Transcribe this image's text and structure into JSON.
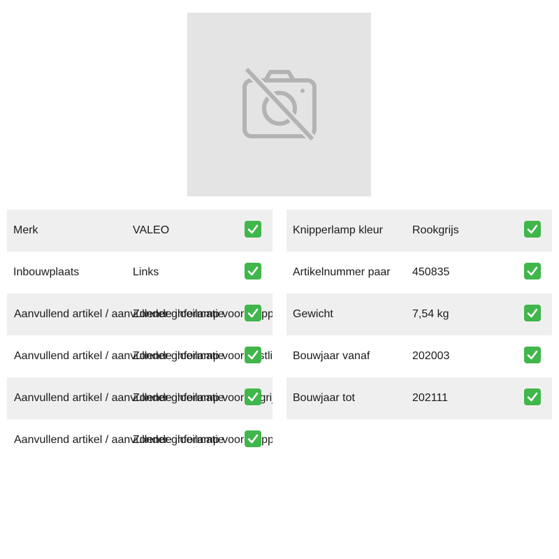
{
  "photo": {
    "icon": "no-camera-icon"
  },
  "left_rows": [
    {
      "label": "Merk",
      "value": "VALEO"
    },
    {
      "label": "Inbouwplaats",
      "value": "Links"
    },
    {
      "label": "Aanvullend artikel / aanvullende informatie",
      "value": "Zonder gloeilamp voor knipperlicht"
    },
    {
      "label": "Aanvullend artikel / aanvullende informatie",
      "value": "Zonder gloeilamp voor mistlicht"
    },
    {
      "label": "Aanvullend artikel / aanvullende informatie",
      "value": "Zonder gloeilamp voor dagrijverlichting"
    },
    {
      "label": "Aanvullend artikel / aanvullende informatie",
      "value": "Zonder gloeilamp voor knipperlicht"
    }
  ],
  "right_rows": [
    {
      "label": "Knipperlamp kleur",
      "value": "Rookgrijs"
    },
    {
      "label": "Artikelnummer paar",
      "value": "450835"
    },
    {
      "label": "Gewicht",
      "value": "7,54 kg"
    },
    {
      "label": "Bouwjaar vanaf",
      "value": "202003"
    },
    {
      "label": "Bouwjaar tot",
      "value": "202111"
    }
  ],
  "check_icon": "check-mark-icon",
  "colors": {
    "shade": "#efefef",
    "check": "#40b64b",
    "photo_bg": "#e4e4e4",
    "icon": "#b3b3b3"
  }
}
